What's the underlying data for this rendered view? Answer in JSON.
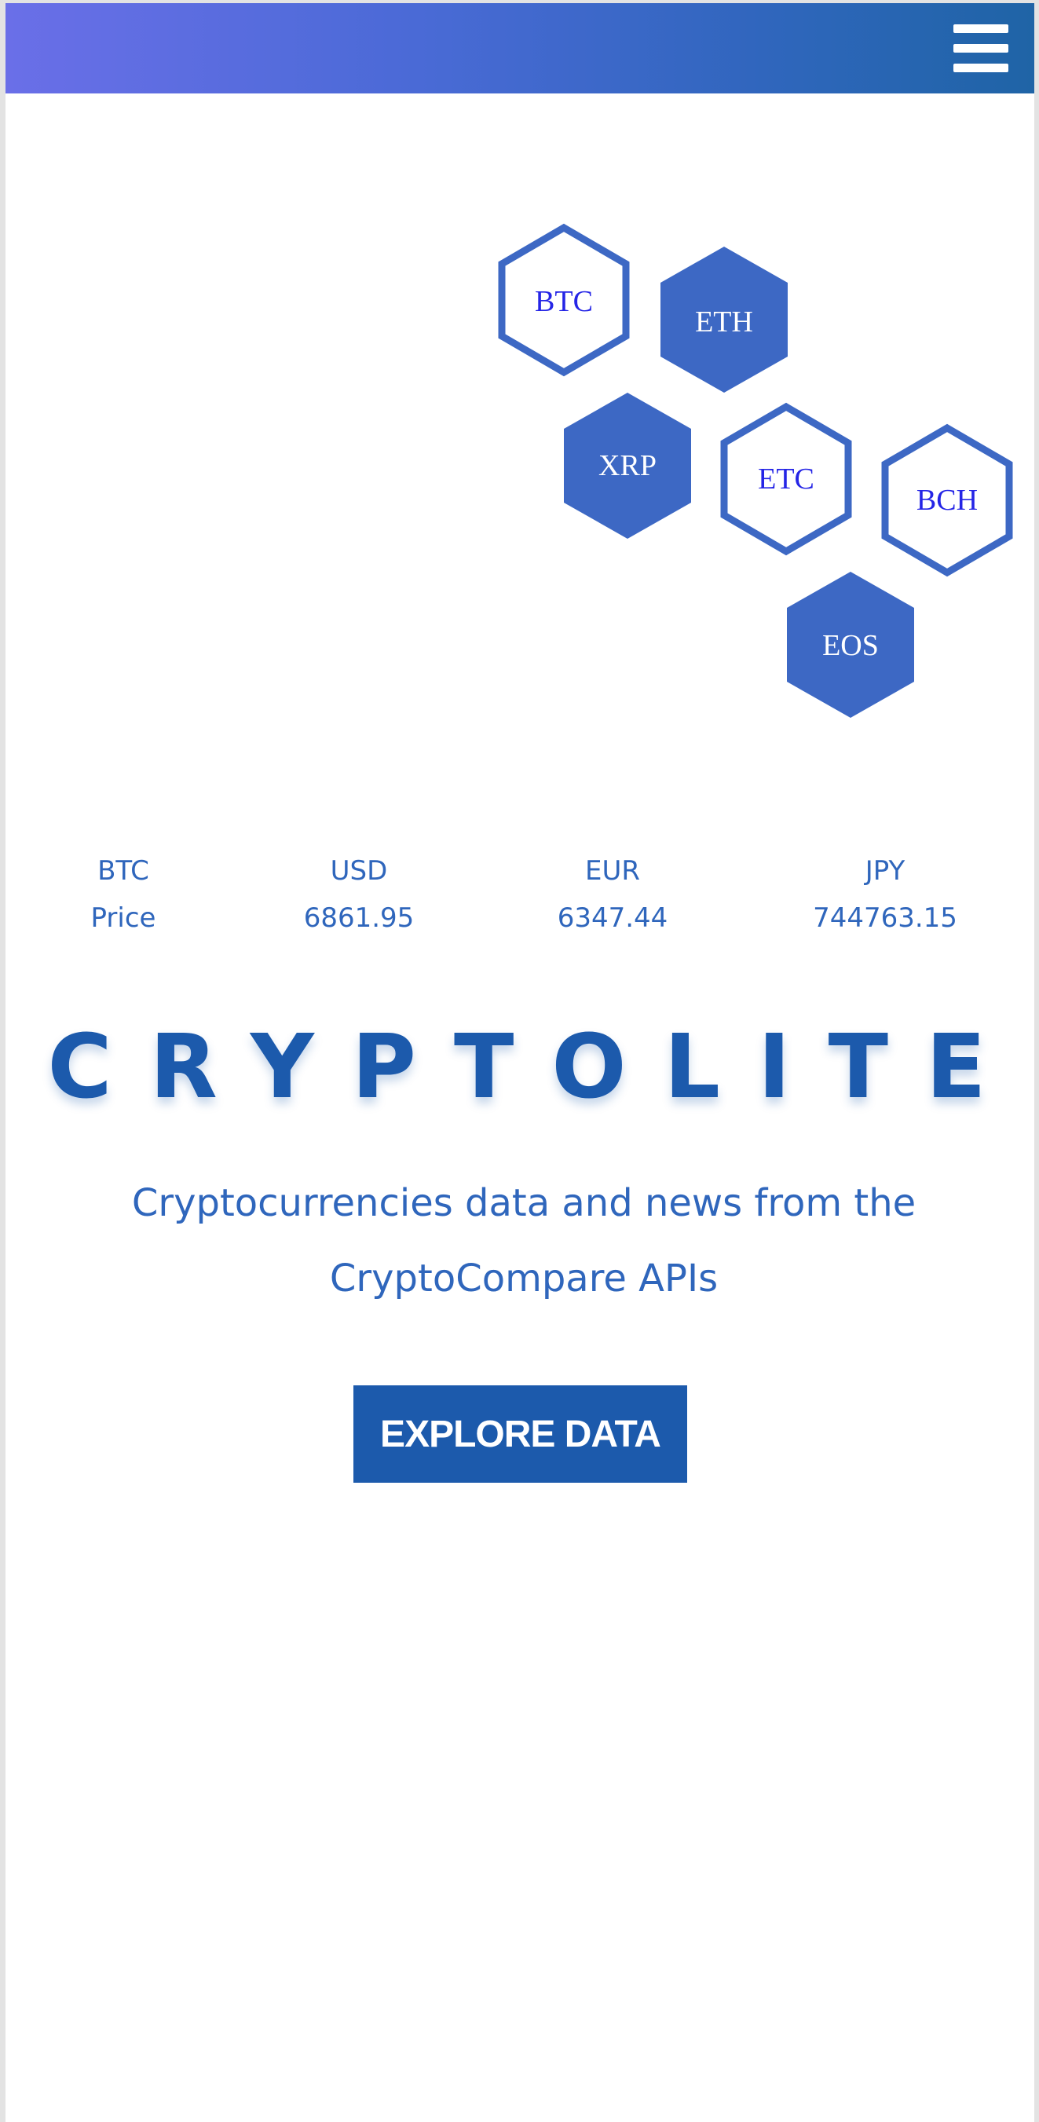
{
  "navbar": {
    "menu_icon": "hamburger-menu-icon",
    "gradient": [
      "#6a6fe8",
      "#1f64a6"
    ]
  },
  "coins": [
    {
      "symbol": "BTC",
      "style": "outline"
    },
    {
      "symbol": "ETH",
      "style": "filled"
    },
    {
      "symbol": "XRP",
      "style": "filled"
    },
    {
      "symbol": "ETC",
      "style": "outline"
    },
    {
      "symbol": "BCH",
      "style": "outline"
    },
    {
      "symbol": "EOS",
      "style": "filled"
    }
  ],
  "prices": {
    "label_top": "BTC",
    "label_bottom": "Price",
    "currencies": [
      {
        "code": "USD",
        "value": "6861.95"
      },
      {
        "code": "EUR",
        "value": "6347.44"
      },
      {
        "code": "JPY",
        "value": "744763.15"
      }
    ]
  },
  "hero": {
    "brand": "CRYPTOLITE",
    "tagline": "Cryptocurrencies data and news from the CryptoCompare APIs",
    "cta_label": "EXPLORE DATA"
  },
  "colors": {
    "primary": "#1c5aac",
    "hex_fill": "#3d68c4",
    "hex_outline_text": "#2525e6"
  }
}
